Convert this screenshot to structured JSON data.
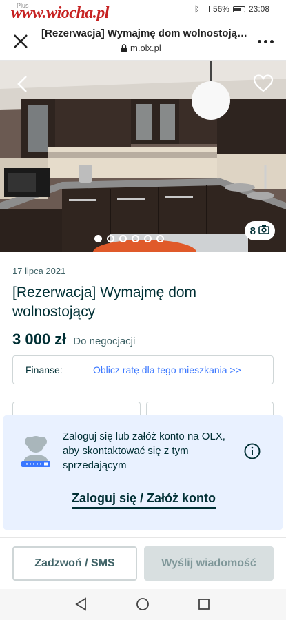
{
  "status_bar": {
    "carrier": "Plus",
    "watermark": "www.wiocha.pl",
    "battery": "56%",
    "time": "23:08"
  },
  "browser": {
    "title": "[Rezerwacja] Wymajmę dom wolnostojący...",
    "url": "m.olx.pl",
    "icons": [
      "close-icon",
      "lock-icon",
      "more-icon"
    ]
  },
  "gallery": {
    "photo_count": "8",
    "total_dots": 6,
    "active_dot": 0,
    "icons": [
      "back-arrow-icon",
      "heart-icon",
      "camera-icon"
    ]
  },
  "ad": {
    "date": "17 lipca 2021",
    "title": "[Rezerwacja] Wymajmę dom wolnostojący",
    "price": "3 000 zł",
    "negotiable": "Do negocjacji"
  },
  "finance": {
    "label": "Finanse:",
    "link": "Oblicz ratę dla tego mieszkania >>"
  },
  "login_prompt": {
    "text": "Zaloguj się lub załóż konto na OLX, aby skontaktować się z tym sprzedającym",
    "link": "Zaloguj się / Załóż konto"
  },
  "actions": {
    "call": "Zadzwoń / SMS",
    "message": "Wyślij wiadomość"
  },
  "colors": {
    "brand_dark": "#002f34",
    "link_blue": "#3a77ff",
    "panel_bg": "#e9f1ff",
    "watermark_red": "#c62222"
  }
}
